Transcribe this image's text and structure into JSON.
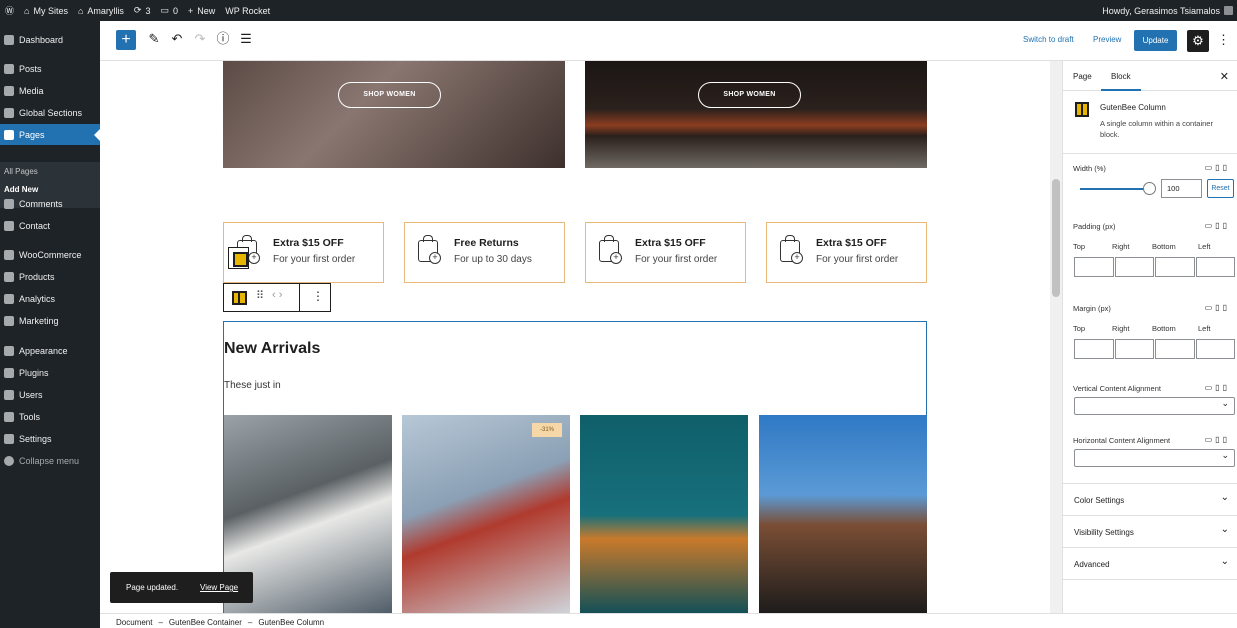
{
  "admin_bar": {
    "my_sites": "My Sites",
    "site_name": "Amaryllis",
    "updates_count": "3",
    "comments_count": "0",
    "new_label": "New",
    "wp_rocket": "WP Rocket",
    "howdy": "Howdy, Gerasimos Tsiamalos"
  },
  "admin_menu": {
    "items": [
      {
        "label": "Dashboard",
        "icon": "dashboard-icon"
      },
      {
        "label": "Posts",
        "icon": "pin-icon"
      },
      {
        "label": "Media",
        "icon": "media-icon"
      },
      {
        "label": "Global Sections",
        "icon": "list-icon"
      },
      {
        "label": "Pages",
        "icon": "pages-icon"
      },
      {
        "label": "Comments",
        "icon": "comment-icon"
      },
      {
        "label": "Contact",
        "icon": "mail-icon"
      },
      {
        "label": "WooCommerce",
        "icon": "woo-icon"
      },
      {
        "label": "Products",
        "icon": "box-icon"
      },
      {
        "label": "Analytics",
        "icon": "chart-icon"
      },
      {
        "label": "Marketing",
        "icon": "megaphone-icon"
      },
      {
        "label": "Appearance",
        "icon": "brush-icon"
      },
      {
        "label": "Plugins",
        "icon": "plug-icon"
      },
      {
        "label": "Users",
        "icon": "user-icon"
      },
      {
        "label": "Tools",
        "icon": "wrench-icon"
      },
      {
        "label": "Settings",
        "icon": "settings-icon"
      },
      {
        "label": "Collapse menu",
        "icon": "collapse-icon"
      }
    ],
    "submenu": [
      "All Pages",
      "Add New"
    ],
    "active": "Pages"
  },
  "editor_header": {
    "switch_to_draft": "Switch to draft",
    "preview": "Preview",
    "update": "Update"
  },
  "canvas": {
    "hero_buttons": [
      "SHOP WOMEN",
      "SHOP WOMEN"
    ],
    "features": [
      {
        "title": "Extra $15 OFF",
        "subtitle": "For your first order"
      },
      {
        "title": "Free Returns",
        "subtitle": "For up to 30 days"
      },
      {
        "title": "Extra $15 OFF",
        "subtitle": "For your first order"
      },
      {
        "title": "Extra $15 OFF",
        "subtitle": "For your first order"
      }
    ],
    "section_title": "New Arrivals",
    "section_subtitle": "These just in",
    "sale_badge": "-31%"
  },
  "sidebar": {
    "tabs": [
      "Page",
      "Block"
    ],
    "active_tab": "Block",
    "block_title": "GutenBee Column",
    "block_description": "A single column within a container block.",
    "width_label": "Width (%)",
    "width_value": "100",
    "reset_label": "Reset",
    "padding_label": "Padding (px)",
    "margin_label": "Margin (px)",
    "sides": [
      "Top",
      "Right",
      "Bottom",
      "Left"
    ],
    "vertical_alignment": "Vertical Content Alignment",
    "horizontal_alignment": "Horizontal Content Alignment",
    "panels": [
      "Color Settings",
      "Visibility Settings",
      "Advanced"
    ]
  },
  "snackbar": {
    "message": "Page updated.",
    "link": "View Page"
  },
  "breadcrumb": [
    "Document",
    "GutenBee Container",
    "GutenBee Column"
  ],
  "colors": {
    "accent": "#2271b1",
    "admin_bg": "#1d2327",
    "feature_border": "#e9b97a",
    "block_icon": "#e8b600"
  }
}
